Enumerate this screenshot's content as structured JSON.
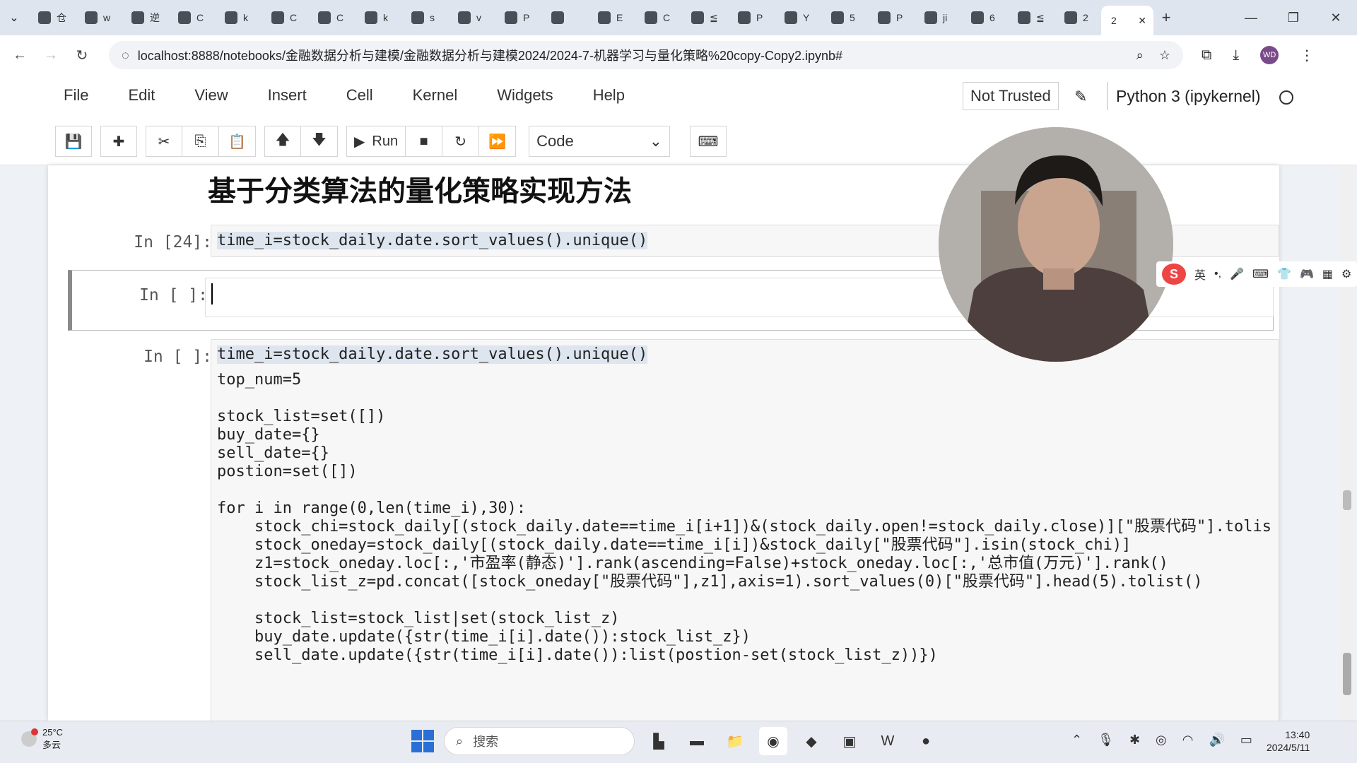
{
  "browser": {
    "tabs": [
      {
        "icon": "bilibili-icon",
        "label": "仓"
      },
      {
        "icon": "github-icon",
        "label": "w"
      },
      {
        "icon": "translate-icon",
        "label": "逆"
      },
      {
        "icon": "csdn-icon",
        "label": "C"
      },
      {
        "icon": "github-icon",
        "label": "k"
      },
      {
        "icon": "cube-icon",
        "label": "C"
      },
      {
        "icon": "video-icon",
        "label": "C"
      },
      {
        "icon": "github-icon",
        "label": "k"
      },
      {
        "icon": "zhihu-icon",
        "label": "s"
      },
      {
        "icon": "github-icon",
        "label": "v"
      },
      {
        "icon": "c-icon",
        "label": "P"
      },
      {
        "icon": "cloud-icon",
        "label": ""
      },
      {
        "icon": "cloud-icon",
        "label": "E"
      },
      {
        "icon": "github-icon",
        "label": "C"
      },
      {
        "icon": "loading-icon",
        "label": "≦"
      },
      {
        "icon": "graduation-icon",
        "label": "P"
      },
      {
        "icon": "youtube-icon",
        "label": "Y"
      },
      {
        "icon": "o-icon",
        "label": "5"
      },
      {
        "icon": "google-icon",
        "label": "P"
      },
      {
        "icon": "bilibili-icon",
        "label": "ji"
      },
      {
        "icon": "chart-icon",
        "label": "6"
      },
      {
        "icon": "loading-icon",
        "label": "≦"
      },
      {
        "icon": "note-icon",
        "label": "2"
      }
    ],
    "active_tab": {
      "label": "2",
      "close": "✕"
    },
    "new_tab": "+",
    "url": "localhost:8888/notebooks/金融数据分析与建模/金融数据分析与建模2024/2024-7-机器学习与量化策略%20copy-Copy2.ipynb#",
    "profile": "WD"
  },
  "jupyter": {
    "menu": [
      "File",
      "Edit",
      "View",
      "Insert",
      "Cell",
      "Kernel",
      "Widgets",
      "Help"
    ],
    "trust": "Not Trusted",
    "kernel": "Python 3 (ipykernel)",
    "run_label": "Run",
    "cell_type": "Code"
  },
  "notebook": {
    "heading": "基于分类算法的量化策略实现方法",
    "cells": [
      {
        "prompt": "In  [24]:",
        "code": [
          "time_i=stock_daily.date.sort_values().unique()"
        ]
      },
      {
        "prompt": "In  [  ]:",
        "code": [
          ""
        ]
      },
      {
        "prompt": "In  [  ]:",
        "code": [
          "time_i=stock_daily.date.sort_values().unique()",
          "top_num=5",
          "",
          "stock_list=set([])",
          "buy_date={}",
          "sell_date={}",
          "postion=set([])",
          "",
          "for i in range(0,len(time_i),30):",
          "    stock_chi=stock_daily[(stock_daily.date==time_i[i+1])&(stock_daily.open!=stock_daily.close)][\"股票代码\"].tolis",
          "    stock_oneday=stock_daily[(stock_daily.date==time_i[i])&stock_daily[\"股票代码\"].isin(stock_chi)]",
          "    z1=stock_oneday.loc[:,'市盈率(静态)'].rank(ascending=False)+stock_oneday.loc[:,'总市值(万元)'].rank()",
          "    stock_list_z=pd.concat([stock_oneday[\"股票代码\"],z1],axis=1).sort_values(0)[\"股票代码\"].head(5).tolist()",
          "",
          "    stock_list=stock_list|set(stock_list_z)",
          "    buy_date.update({str(time_i[i].date()):stock_list_z})",
          "    sell_date.update({str(time_i[i].date()):list(postion-set(stock_list_z))})"
        ]
      }
    ]
  },
  "ime": {
    "lang": "英"
  },
  "taskbar": {
    "temp": "25°C",
    "weather": "多云",
    "search_placeholder": "搜索",
    "time": "13:40",
    "date": "2024/5/11"
  }
}
